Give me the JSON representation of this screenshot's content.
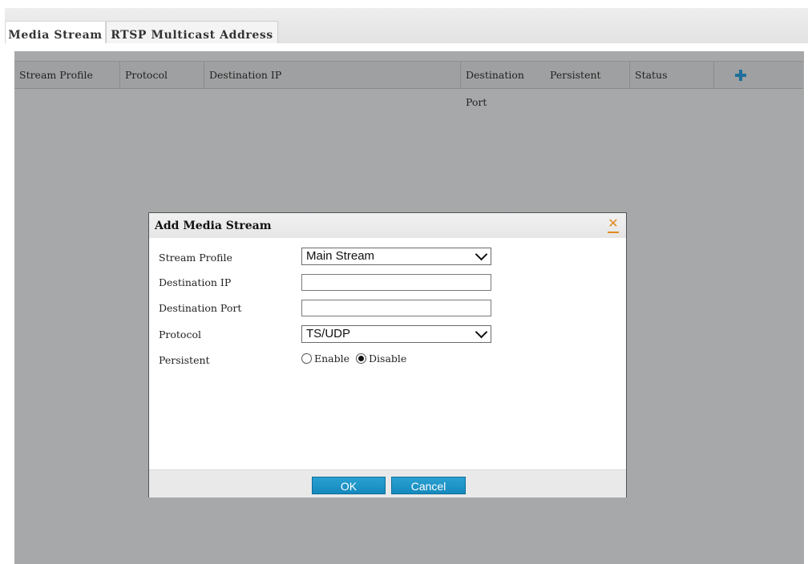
{
  "tabs": [
    {
      "label": "Media Stream",
      "active": true
    },
    {
      "label": "RTSP Multicast Address",
      "active": false
    }
  ],
  "table": {
    "columns": [
      "Stream Profile",
      "Protocol",
      "Destination IP",
      "Destination Port",
      "Persistent",
      "Status"
    ],
    "add_icon": "plus-icon",
    "rows": []
  },
  "dialog": {
    "title": "Add Media Stream",
    "close_icon": "close-icon",
    "fields": {
      "stream_profile": {
        "label": "Stream Profile",
        "value": "Main Stream"
      },
      "destination_ip": {
        "label": "Destination IP",
        "value": ""
      },
      "destination_port": {
        "label": "Destination Port",
        "value": ""
      },
      "protocol": {
        "label": "Protocol",
        "value": "TS/UDP"
      },
      "persistent": {
        "label": "Persistent",
        "options": [
          "Enable",
          "Disable"
        ],
        "selected": "Disable"
      }
    },
    "ok_label": "OK",
    "cancel_label": "Cancel"
  },
  "colors": {
    "accent": "#1e8ec2",
    "overlay": "#a7a8a9",
    "close": "#e08a1e"
  }
}
